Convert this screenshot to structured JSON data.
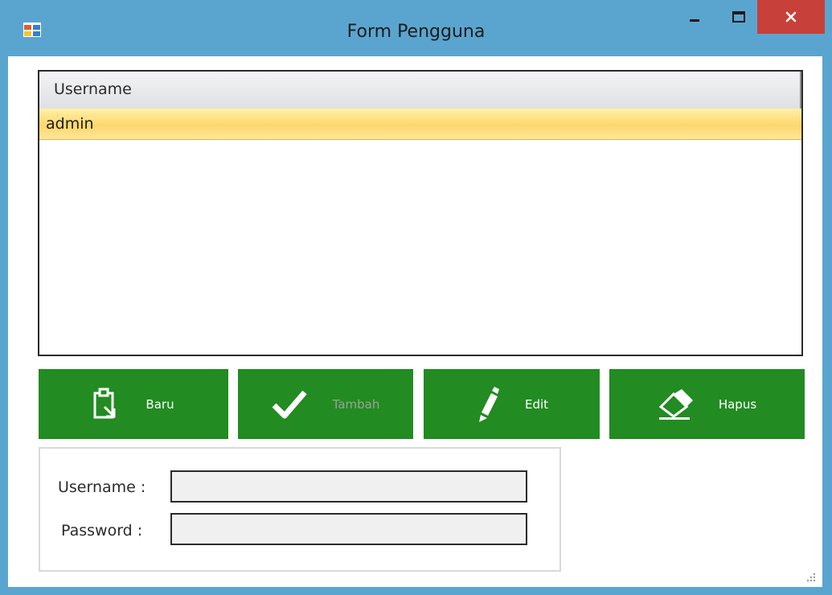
{
  "window": {
    "title": "Form Pengguna",
    "controls": [
      "minimize-icon",
      "maximize-icon",
      "close-icon"
    ],
    "colors": {
      "frame": "#5aa5cf",
      "close": "#c7403a"
    }
  },
  "grid": {
    "column_header": "Username",
    "rows": [
      "admin"
    ],
    "colors": {
      "selected_row": "#fdd76c"
    }
  },
  "toolbar": {
    "accent": "#228b22",
    "buttons": [
      {
        "label": "Baru",
        "icon": "clipboard-icon",
        "enabled": true
      },
      {
        "label": "Tambah",
        "icon": "checkmark-icon",
        "enabled": false
      },
      {
        "label": "Edit",
        "icon": "pencil-icon",
        "enabled": true
      },
      {
        "label": "Hapus",
        "icon": "eraser-icon",
        "enabled": true
      }
    ]
  },
  "form": {
    "username_label": "Username :",
    "password_label": "Password :",
    "username_value": "",
    "password_value": ""
  }
}
